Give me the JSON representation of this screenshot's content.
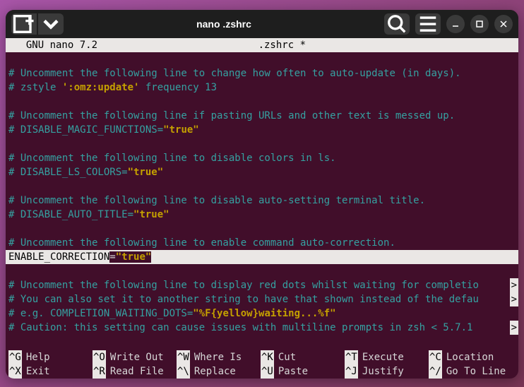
{
  "titlebar": {
    "title": "nano .zshrc"
  },
  "status": {
    "app": "  GNU nano 7.2                           ",
    "file": ".zshrc *"
  },
  "lines": [
    {
      "type": "blank",
      "text": ""
    },
    {
      "type": "comment",
      "text": "# Uncomment the following line to change how often to auto-update (in days)."
    },
    {
      "type": "comment-quoted",
      "prefix": "# zstyle ",
      "quoted": "':omz:update'",
      "suffix": " frequency 13"
    },
    {
      "type": "blank",
      "text": ""
    },
    {
      "type": "comment",
      "text": "# Uncomment the following line if pasting URLs and other text is messed up."
    },
    {
      "type": "setting",
      "prefix": "# DISABLE_MAGIC_FUNCTIONS=",
      "quoted": "\"true\""
    },
    {
      "type": "blank",
      "text": ""
    },
    {
      "type": "comment",
      "text": "# Uncomment the following line to disable colors in ls."
    },
    {
      "type": "setting",
      "prefix": "# DISABLE_LS_COLORS=",
      "quoted": "\"true\""
    },
    {
      "type": "blank",
      "text": ""
    },
    {
      "type": "comment",
      "text": "# Uncomment the following line to disable auto-setting terminal title."
    },
    {
      "type": "setting",
      "prefix": "# DISABLE_AUTO_TITLE=",
      "quoted": "\"true\""
    },
    {
      "type": "blank",
      "text": ""
    },
    {
      "type": "comment",
      "text": "# Uncomment the following line to enable command auto-correction."
    },
    {
      "type": "highlight",
      "var": "ENABLE_CORRECTION",
      "eq": "=",
      "quoted": "\"true\""
    },
    {
      "type": "blank",
      "text": ""
    },
    {
      "type": "comment-over",
      "text": "# Uncomment the following line to display red dots whilst waiting for completio",
      "ind": ">"
    },
    {
      "type": "comment-over",
      "text": "# You can also set it to another string to have that shown instead of the defau",
      "ind": ">"
    },
    {
      "type": "setting",
      "prefix": "# e.g. COMPLETION_WAITING_DOTS=",
      "quoted": "\"%F{yellow}waiting...%f\""
    },
    {
      "type": "comment-over",
      "text": "# Caution: this setting can cause issues with multiline prompts in zsh < 5.7.1 ",
      "ind": ">"
    }
  ],
  "help": {
    "row1": [
      {
        "key": "^G",
        "label": "Help"
      },
      {
        "key": "^O",
        "label": "Write Out"
      },
      {
        "key": "^W",
        "label": "Where Is"
      },
      {
        "key": "^K",
        "label": "Cut"
      },
      {
        "key": "^T",
        "label": "Execute"
      },
      {
        "key": "^C",
        "label": "Location"
      }
    ],
    "row2": [
      {
        "key": "^X",
        "label": "Exit"
      },
      {
        "key": "^R",
        "label": "Read File"
      },
      {
        "key": "^\\",
        "label": "Replace"
      },
      {
        "key": "^U",
        "label": "Paste"
      },
      {
        "key": "^J",
        "label": "Justify"
      },
      {
        "key": "^/",
        "label": "Go To Line"
      }
    ]
  }
}
